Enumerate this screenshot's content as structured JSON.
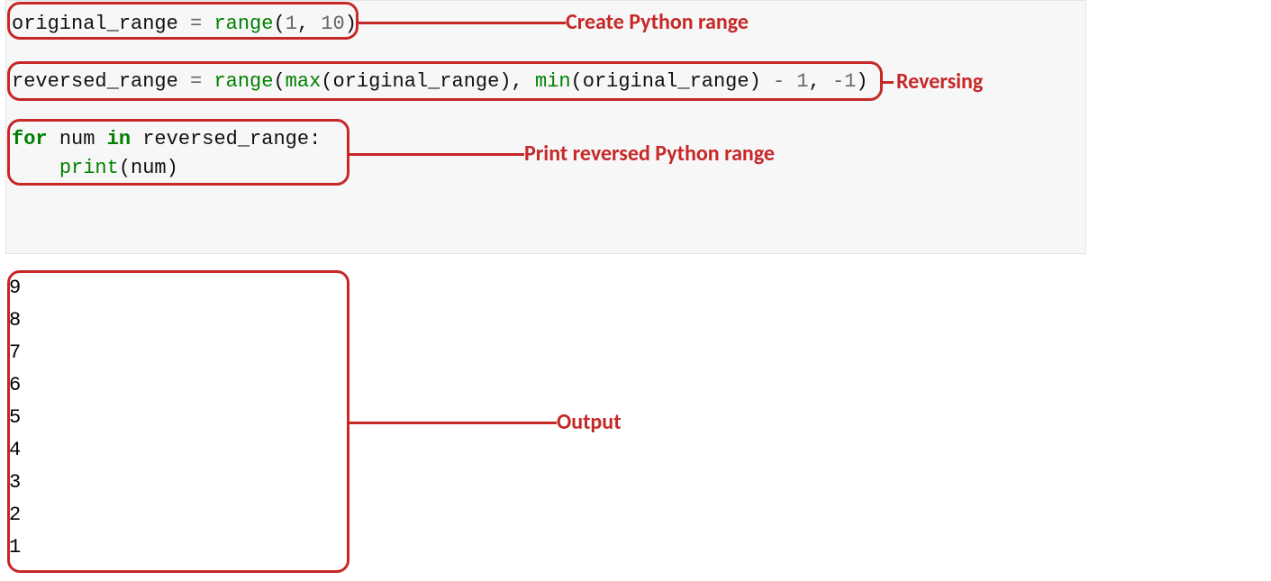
{
  "code": {
    "line1": {
      "var": "original_range",
      "eq": " = ",
      "fn": "range",
      "open": "(",
      "a1": "1",
      "comma": ", ",
      "a2": "10",
      "close": ")"
    },
    "line3": {
      "var": "reversed_range",
      "eq": " = ",
      "fn": "range",
      "open": "(",
      "max": "max",
      "p1o": "(",
      "arg1": "original_range",
      "p1c": ")",
      "comma1": ", ",
      "min": "min",
      "p2o": "(",
      "arg2": "original_range",
      "p2c": ")",
      "minus": " - ",
      "one": "1",
      "comma2": ", ",
      "neg": "-",
      "one2": "1",
      "close": ")"
    },
    "line5": {
      "for": "for",
      "sp1": " ",
      "num": "num",
      "sp2": " ",
      "in": "in",
      "sp3": " ",
      "rr": "reversed_range",
      "colon": ":"
    },
    "line6": {
      "indent": "    ",
      "print": "print",
      "open": "(",
      "arg": "num",
      "close": ")"
    }
  },
  "annotations": {
    "create": "Create Python range",
    "reverse": "Reversing",
    "print": "Print reversed Python range",
    "output": "Output"
  },
  "output": [
    "9",
    "8",
    "7",
    "6",
    "5",
    "4",
    "3",
    "2",
    "1"
  ]
}
